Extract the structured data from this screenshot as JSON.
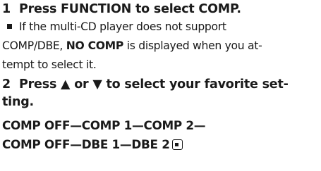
{
  "step1": {
    "number": "1",
    "text": "Press FUNCTION to select COMP."
  },
  "note": {
    "line1": "If the multi-CD player does not support",
    "line2_prefix": "COMP/DBE, ",
    "line2_bold": "NO COMP",
    "line2_suffix": " is displayed when you at-",
    "line3": "tempt to select it."
  },
  "step2": {
    "number": "2",
    "line1": "Press ▲ or ▼ to select your favorite set-",
    "line2": "ting."
  },
  "settings": {
    "line1": "COMP OFF—COMP 1—COMP 2—",
    "line2": "COMP OFF—DBE 1—DBE 2"
  },
  "icons": {
    "bullet": "square-bullet-icon",
    "end_mark": "end-of-section-icon"
  }
}
